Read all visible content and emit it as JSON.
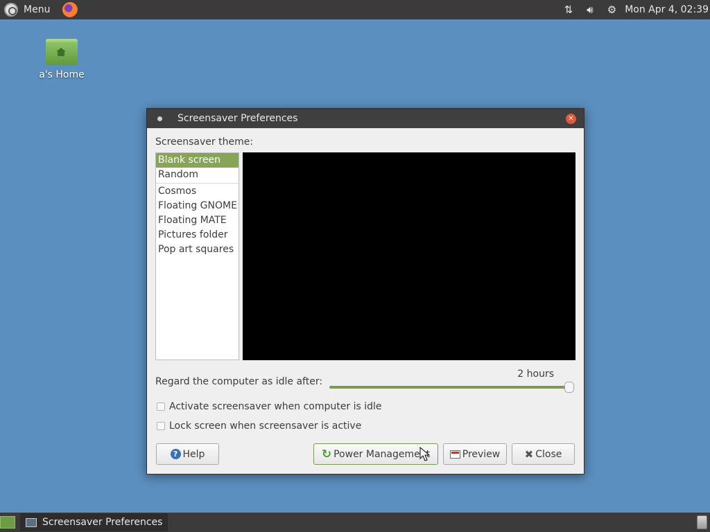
{
  "top_panel": {
    "menu_label": "Menu",
    "clock": "Mon Apr  4, 02:39"
  },
  "desktop": {
    "home_label": "a's Home"
  },
  "dialog": {
    "title": "Screensaver Preferences",
    "theme_label": "Screensaver theme:",
    "themes": [
      "Blank screen",
      "Random",
      "Cosmos",
      "Floating GNOME",
      "Floating MATE",
      "Pictures folder",
      "Pop art squares"
    ],
    "selected_theme": "Blank screen",
    "idle_label": "Regard the computer as idle after:",
    "idle_value": "2 hours",
    "idle_slider_fraction": 1.0,
    "checkbox_activate": "Activate screensaver when computer is idle",
    "checkbox_activate_checked": false,
    "checkbox_lock": "Lock screen when screensaver is active",
    "checkbox_lock_checked": false,
    "buttons": {
      "help": "Help",
      "power": "Power Management",
      "preview": "Preview",
      "close": "Close"
    }
  },
  "taskbar": {
    "task_label": "Screensaver Preferences"
  },
  "colors": {
    "desktop_bg": "#5b8fbf",
    "panel_bg": "#3b3b3b",
    "selection": "#87a556",
    "accent_green": "#7a9a52"
  }
}
